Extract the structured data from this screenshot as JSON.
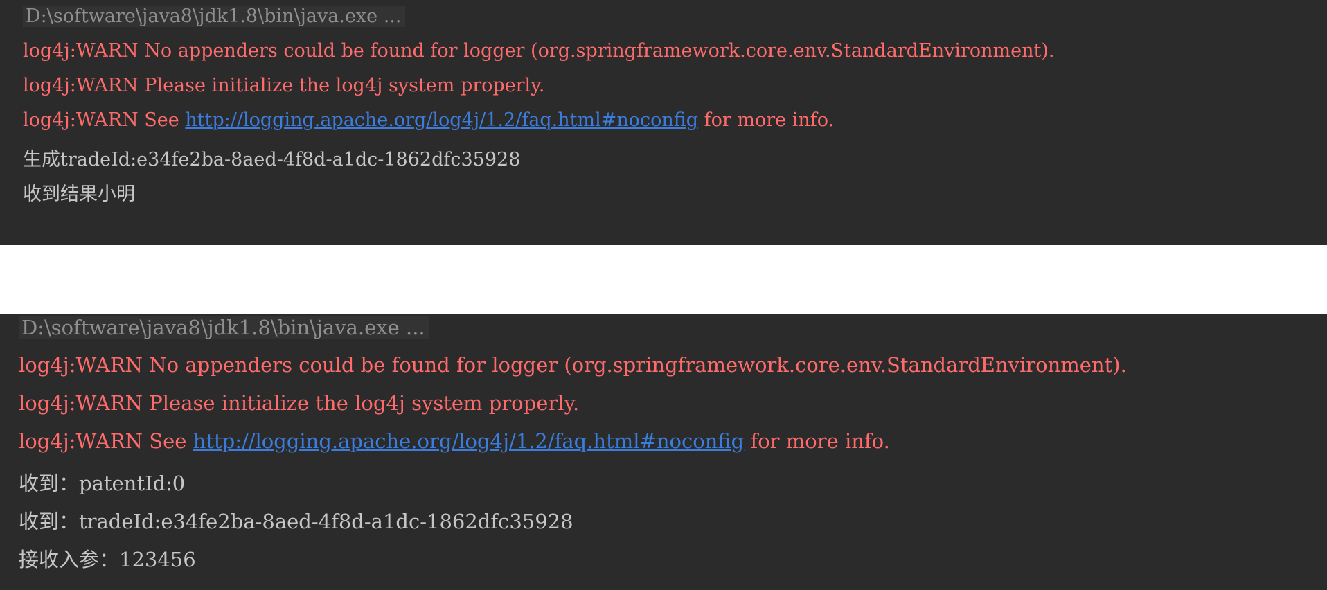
{
  "top_console": {
    "command": "D:\\software\\java8\\jdk1.8\\bin\\java.exe ...",
    "warn_line1": "log4j:WARN No appenders could be found for logger (org.springframework.core.env.StandardEnvironment).",
    "warn_line2": "log4j:WARN Please initialize the log4j system properly.",
    "warn_line3_prefix": "log4j:WARN See ",
    "warn_line3_link": "http://logging.apache.org/log4j/1.2/faq.html#noconfig",
    "warn_line3_suffix": " for more info.",
    "output_line1": "生成tradeId:e34fe2ba-8aed-4f8d-a1dc-1862dfc35928",
    "output_line2": "收到结果小明"
  },
  "bottom_console": {
    "command": "D:\\software\\java8\\jdk1.8\\bin\\java.exe ...",
    "warn_line1": "log4j:WARN No appenders could be found for logger (org.springframework.core.env.StandardEnvironment).",
    "warn_line2": "log4j:WARN Please initialize the log4j system properly.",
    "warn_line3_prefix": "log4j:WARN See ",
    "warn_line3_link": "http://logging.apache.org/log4j/1.2/faq.html#noconfig",
    "warn_line3_suffix": " for more info.",
    "output_line1": "收到：patentId:0",
    "output_line2": "收到：tradeId:e34fe2ba-8aed-4f8d-a1dc-1862dfc35928",
    "output_line3": "接收入参：123456"
  },
  "colors": {
    "background": "#2b2b2b",
    "warn": "#ff6b6b",
    "plain": "#c6c6c6",
    "link": "#3b7ddd",
    "command": "#8f8f8f"
  }
}
